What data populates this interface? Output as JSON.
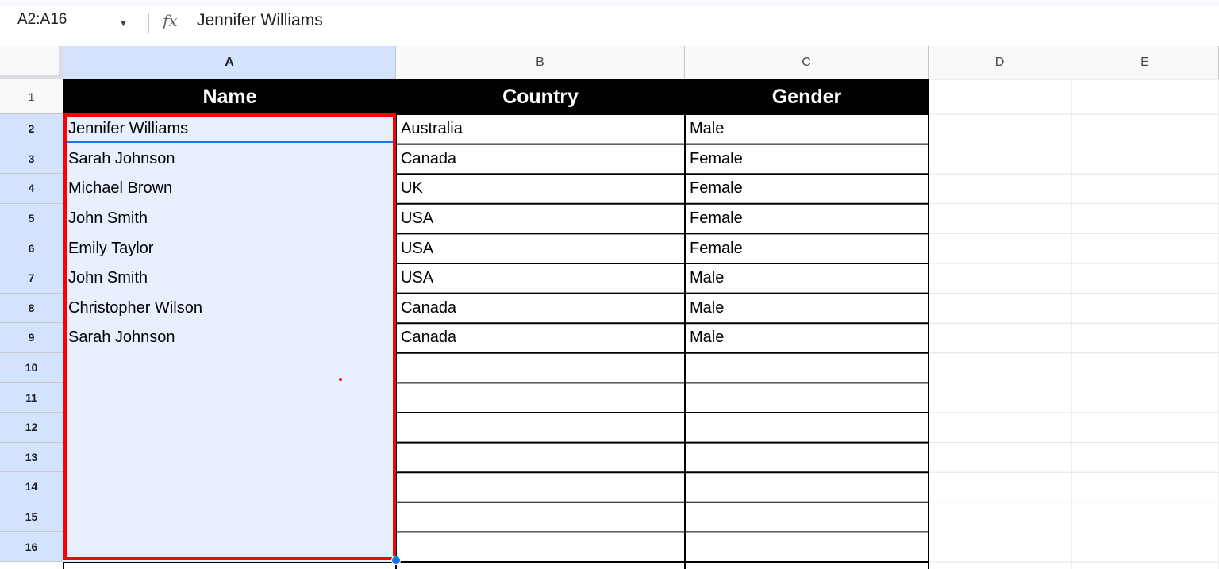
{
  "formula_bar": {
    "name_box": "A2:A16",
    "fx_label": "fx",
    "value": "Jennifer Williams"
  },
  "columns": [
    "A",
    "B",
    "C",
    "D",
    "E"
  ],
  "rows": [
    "1",
    "2",
    "3",
    "4",
    "5",
    "6",
    "7",
    "8",
    "9",
    "10",
    "11",
    "12",
    "13",
    "14",
    "15",
    "16"
  ],
  "sheet": {
    "headers": [
      "Name",
      "Country",
      "Gender"
    ],
    "data": [
      [
        "Jennifer Williams",
        "Australia",
        "Male"
      ],
      [
        "Sarah Johnson",
        "Canada",
        "Female"
      ],
      [
        "Michael Brown",
        "UK",
        "Female"
      ],
      [
        "John Smith",
        "USA",
        "Female"
      ],
      [
        "Emily Taylor",
        "USA",
        "Female"
      ],
      [
        "John Smith",
        "USA",
        "Male"
      ],
      [
        "Christopher Wilson",
        "Canada",
        "Male"
      ],
      [
        "Sarah Johnson",
        "Canada",
        "Male"
      ]
    ]
  },
  "colors": {
    "selection_border": "#ff0000",
    "selection_fill": "#e8f0fe",
    "header_bg": "#000000",
    "accent": "#1a73e8"
  }
}
